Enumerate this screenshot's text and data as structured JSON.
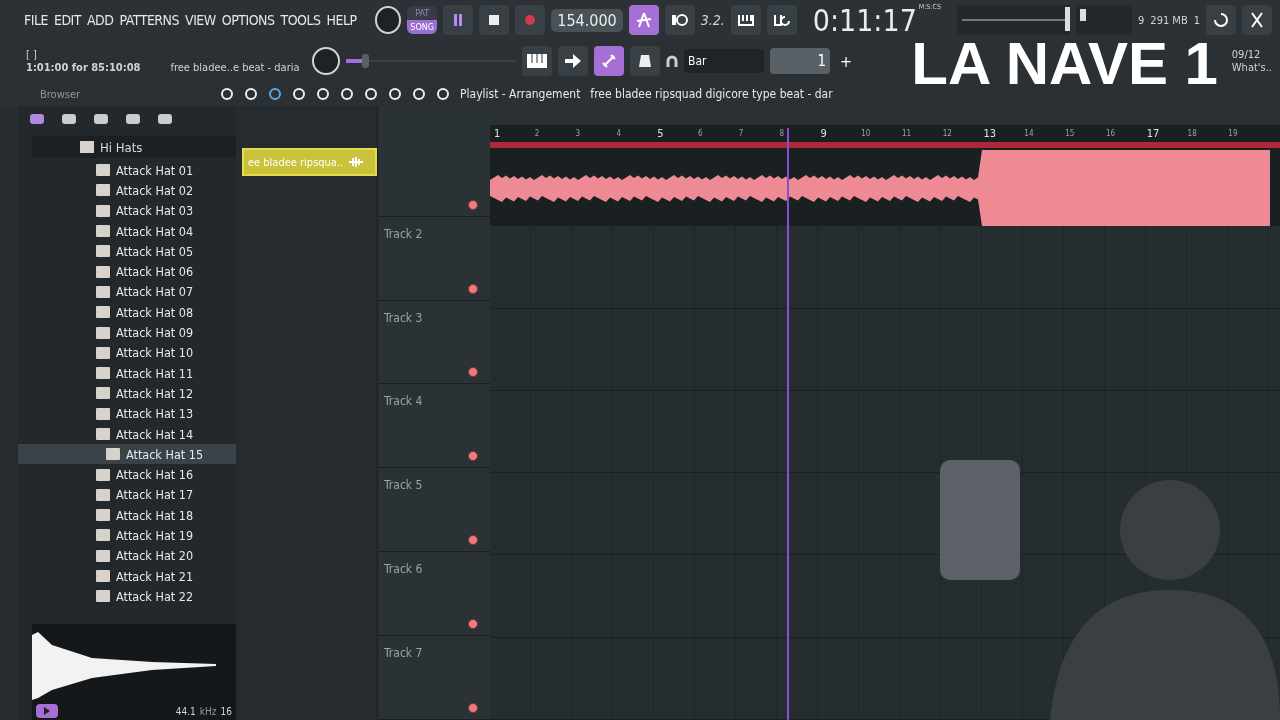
{
  "menu": [
    "FILE",
    "EDIT",
    "ADD",
    "PATTERNS",
    "VIEW",
    "OPTIONS",
    "TOOLS",
    "HELP"
  ],
  "hint": {
    "bracket": "[    ]",
    "position": "1:01:00 for 85:10:08",
    "song": "free bladee..e beat - daria"
  },
  "transport": {
    "pat": "PAT",
    "song": "SONG",
    "song_mode": true,
    "playing": true,
    "recording": false,
    "tempo": "154.000",
    "time": "0:11:17",
    "time_unit": "M:S:CS",
    "pattern_digits": "3.2."
  },
  "monitor": {
    "voices": "9",
    "memory": "291 MB",
    "cpu": "1"
  },
  "snap": "Bar",
  "pattern": "1",
  "plus": "+",
  "news": {
    "date": "09/12",
    "text": "What's.."
  },
  "browser": {
    "title": "Browser",
    "folder": "Hi Hats",
    "items": [
      {
        "label": "Attack Hat 01",
        "selected": false
      },
      {
        "label": "Attack Hat 02",
        "selected": false
      },
      {
        "label": "Attack Hat 03",
        "selected": false
      },
      {
        "label": "Attack Hat 04",
        "selected": false
      },
      {
        "label": "Attack Hat 05",
        "selected": false
      },
      {
        "label": "Attack Hat 06",
        "selected": false
      },
      {
        "label": "Attack Hat 07",
        "selected": false
      },
      {
        "label": "Attack Hat 08",
        "selected": false
      },
      {
        "label": "Attack Hat 09",
        "selected": false
      },
      {
        "label": "Attack Hat 10",
        "selected": false
      },
      {
        "label": "Attack Hat 11",
        "selected": false
      },
      {
        "label": "Attack Hat 12",
        "selected": false
      },
      {
        "label": "Attack Hat 13",
        "selected": false
      },
      {
        "label": "Attack Hat 14",
        "selected": false
      },
      {
        "label": "Attack Hat 15",
        "selected": true
      },
      {
        "label": "Attack Hat 16",
        "selected": false
      },
      {
        "label": "Attack Hat 17",
        "selected": false
      },
      {
        "label": "Attack Hat 18",
        "selected": false
      },
      {
        "label": "Attack Hat 19",
        "selected": false
      },
      {
        "label": "Attack Hat 20",
        "selected": false
      },
      {
        "label": "Attack Hat 21",
        "selected": false
      },
      {
        "label": "Attack Hat 22",
        "selected": false
      }
    ],
    "sample": {
      "rate": "44.1",
      "unit": "kHz",
      "bits": "16"
    }
  },
  "clip": "ee bladee  ripsqua..",
  "playlist": {
    "title": "Playlist - Arrangement",
    "song": "free bladee  ripsquad  digicore type beat - dar",
    "ruler": [
      "1",
      "2",
      "3",
      "4",
      "5",
      "6",
      "7",
      "8",
      "9",
      "10",
      "11",
      "12",
      "13",
      "14",
      "15",
      "16",
      "17",
      "18",
      "19"
    ],
    "playhead": {
      "level": 0.375
    },
    "tracks": [
      {
        "name": "Track 2"
      },
      {
        "name": "Track 3"
      },
      {
        "name": "Track 4"
      },
      {
        "name": "Track 5"
      },
      {
        "name": "Track 6"
      },
      {
        "name": "Track 7"
      }
    ]
  },
  "pitch": {
    "level": 0.1
  },
  "overlay": "LA NAVE 1"
}
